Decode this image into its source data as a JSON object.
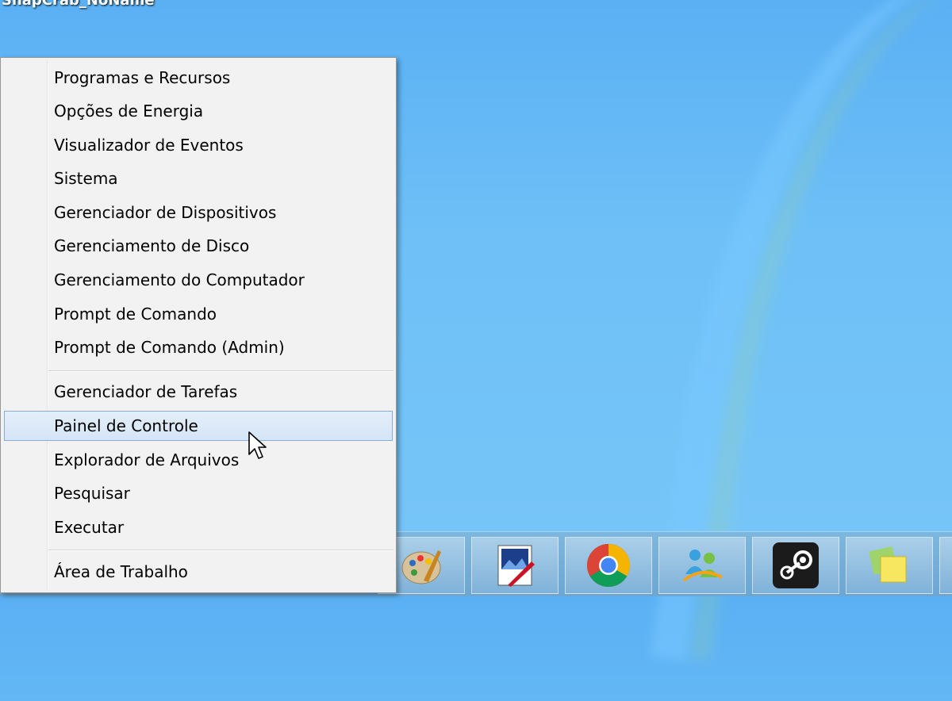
{
  "desktop": {
    "label": "SnapCrab_NoName"
  },
  "menu": {
    "group1": [
      "Programas e Recursos",
      "Opções de Energia",
      "Visualizador de Eventos",
      "Sistema",
      "Gerenciador de Dispositivos",
      "Gerenciamento de Disco",
      "Gerenciamento do Computador",
      "Prompt de Comando",
      "Prompt de Comando (Admin)"
    ],
    "group2": [
      "Gerenciador de Tarefas",
      "Painel de Controle",
      "Explorador de Arquivos",
      "Pesquisar",
      "Executar"
    ],
    "group3": [
      "Área de Trabalho"
    ],
    "highlighted": "Painel de Controle"
  },
  "taskbar": {
    "icons": [
      "paint-icon",
      "media-editor-icon",
      "chrome-icon",
      "messenger-icon",
      "steam-icon",
      "sticky-notes-icon"
    ]
  },
  "colors": {
    "desktop_bg": "#6ec0f7",
    "menu_bg": "#f2f2f2",
    "highlight_bg": "#d5e5f6",
    "highlight_border": "#84acdd"
  }
}
